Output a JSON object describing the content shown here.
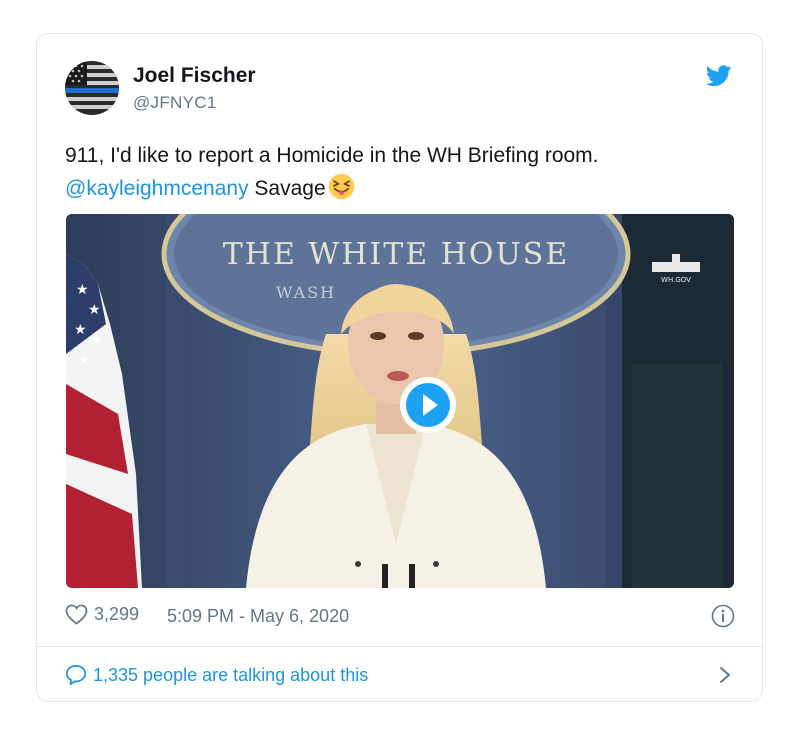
{
  "author": {
    "name": "Joel Fischer",
    "handle": "@JFNYC1"
  },
  "tweet": {
    "text_line1": "911, I'd like to report a Homicide in the WH Briefing room.",
    "mention": "@kayleighmcenany",
    "text_after_mention": " Savage"
  },
  "media": {
    "seal_text": "THE WHITE HOUSE",
    "seal_subtext": "WASH",
    "watermark": "WH.GOV"
  },
  "meta": {
    "likes": "3,299",
    "timestamp": "5:09 PM - May 6, 2020"
  },
  "footer": {
    "talking": "1,335 people are talking about this"
  },
  "colors": {
    "link": "#1b95e0",
    "muted": "#657786",
    "text": "#14171a"
  }
}
